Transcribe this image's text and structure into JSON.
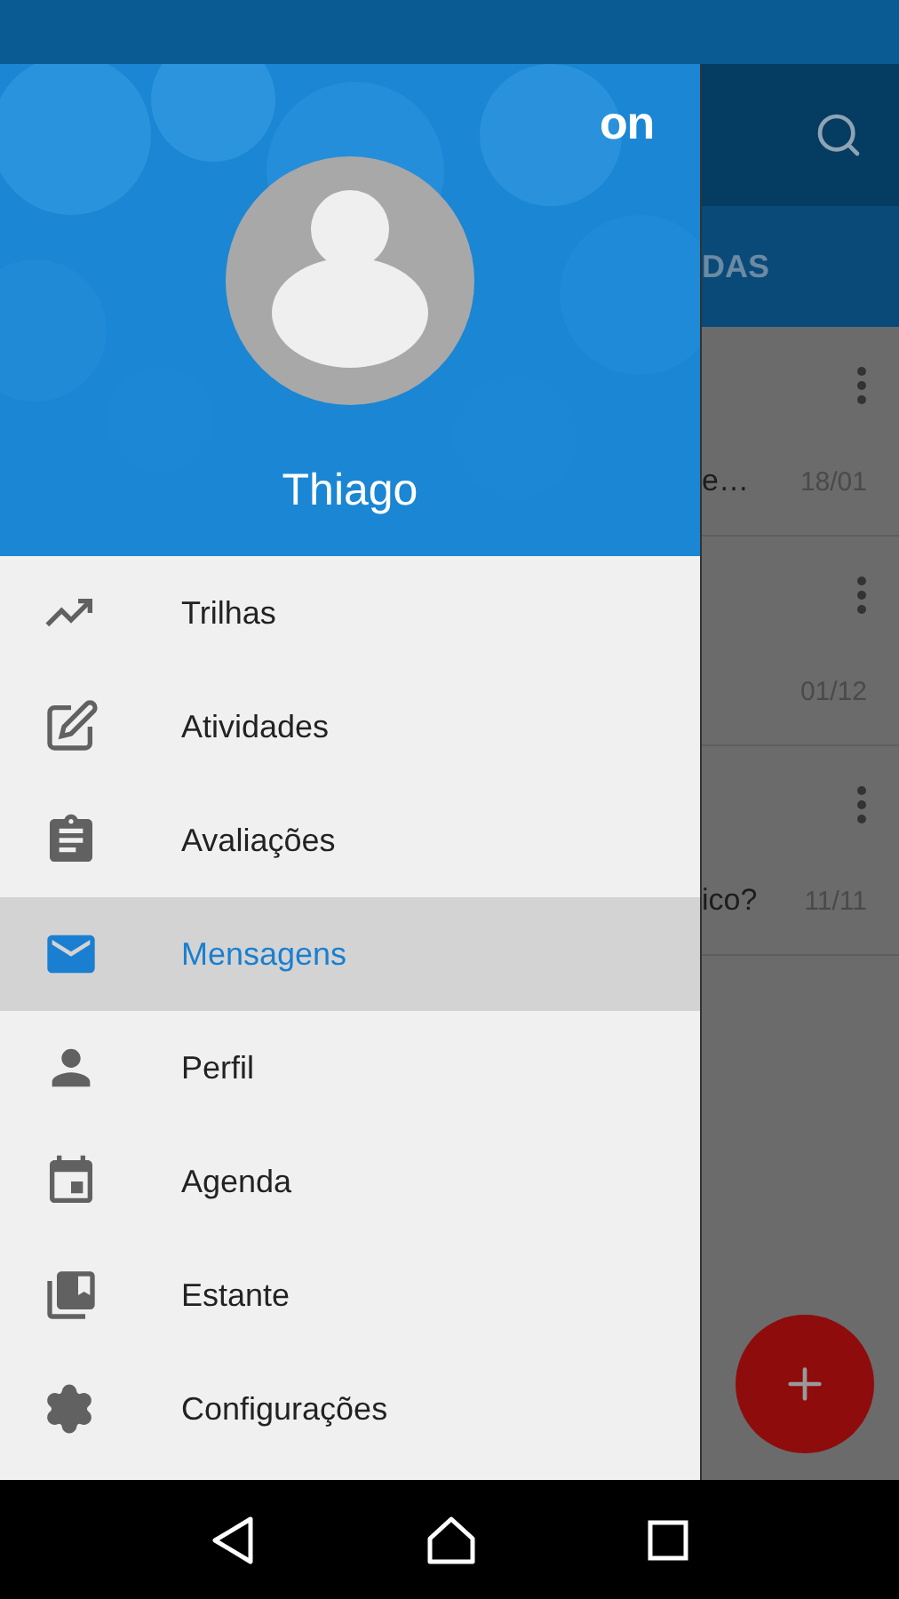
{
  "drawer": {
    "brand": "on",
    "user_name": "Thiago",
    "items": [
      {
        "label": "Trilhas",
        "selected": false
      },
      {
        "label": "Atividades",
        "selected": false
      },
      {
        "label": "Avaliações",
        "selected": false
      },
      {
        "label": "Mensagens",
        "selected": true
      },
      {
        "label": "Perfil",
        "selected": false
      },
      {
        "label": "Agenda",
        "selected": false
      },
      {
        "label": "Estante",
        "selected": false
      },
      {
        "label": "Configurações",
        "selected": false
      }
    ]
  },
  "background": {
    "tab_label": "DAS",
    "messages": [
      {
        "snippet": "e…",
        "date": "18/01"
      },
      {
        "date": "01/12"
      },
      {
        "snippet": "ico?",
        "date": "11/11"
      }
    ]
  }
}
